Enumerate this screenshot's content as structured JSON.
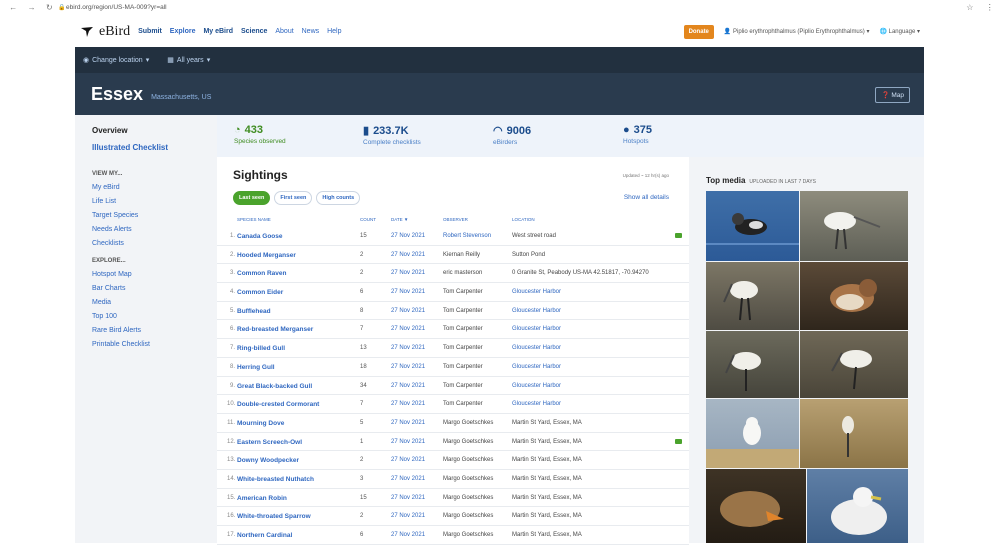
{
  "browser": {
    "url": "ebird.org/region/US-MA-009?yr=all"
  },
  "header": {
    "logo_text": "eBird",
    "nav": [
      "Submit",
      "Explore",
      "My eBird",
      "Science",
      "About",
      "News",
      "Help"
    ],
    "donate": "Donate",
    "user": "Piplio erythrophthalmus (Piplio Erythrophthalmus)",
    "language": "Language"
  },
  "subbar": {
    "change_location": "Change location",
    "years": "All years"
  },
  "banner": {
    "region": "Essex",
    "subregion": "Massachusetts, US",
    "map": "Map"
  },
  "sidebar": {
    "overview": "Overview",
    "illustrated": "Illustrated Checklist",
    "view_my_heading": "VIEW MY...",
    "view_my": [
      "My eBird",
      "Life List",
      "Target Species",
      "Needs Alerts",
      "Checklists"
    ],
    "explore_heading": "EXPLORE...",
    "explore": [
      "Hotspot Map",
      "Bar Charts",
      "Media",
      "Top 100",
      "Rare Bird Alerts",
      "Printable Checklist"
    ]
  },
  "stats": [
    {
      "value": "433",
      "label": "Species observed"
    },
    {
      "value": "233.7K",
      "label": "Complete checklists"
    },
    {
      "value": "9006",
      "label": "eBirders"
    },
    {
      "value": "375",
      "label": "Hotspots"
    }
  ],
  "sightings": {
    "title": "Sightings",
    "updated": "Updated ~ 12 hr(s) ago",
    "tabs": [
      "Last seen",
      "First seen",
      "High counts"
    ],
    "show_all": "Show all details",
    "columns": {
      "species": "SPECIES NAME",
      "count": "COUNT",
      "date": "DATE ▼",
      "observer": "OBSERVER",
      "location": "LOCATION"
    },
    "rows": [
      {
        "n": "1.",
        "species": "Canada Goose",
        "count": "15",
        "date": "27 Nov 2021",
        "observer": "Robert Stevenson",
        "location": "West street road",
        "comment": true
      },
      {
        "n": "2.",
        "species": "Hooded Merganser",
        "count": "2",
        "date": "27 Nov 2021",
        "observer": "Kiernan Reilly",
        "location": "Sutton Pond",
        "comment": false
      },
      {
        "n": "3.",
        "species": "Common Raven",
        "count": "2",
        "date": "27 Nov 2021",
        "observer": "eric masterson",
        "location": "0 Granite St, Peabody US-MA 42.51817, -70.94270",
        "comment": false
      },
      {
        "n": "4.",
        "species": "Common Eider",
        "count": "6",
        "date": "27 Nov 2021",
        "observer": "Tom Carpenter",
        "location": "Gloucester Harbor",
        "comment": false
      },
      {
        "n": "5.",
        "species": "Bufflehead",
        "count": "8",
        "date": "27 Nov 2021",
        "observer": "Tom Carpenter",
        "location": "Gloucester Harbor",
        "comment": false
      },
      {
        "n": "6.",
        "species": "Red-breasted Merganser",
        "count": "7",
        "date": "27 Nov 2021",
        "observer": "Tom Carpenter",
        "location": "Gloucester Harbor",
        "comment": false
      },
      {
        "n": "7.",
        "species": "Ring-billed Gull",
        "count": "13",
        "date": "27 Nov 2021",
        "observer": "Tom Carpenter",
        "location": "Gloucester Harbor",
        "comment": false
      },
      {
        "n": "8.",
        "species": "Herring Gull",
        "count": "18",
        "date": "27 Nov 2021",
        "observer": "Tom Carpenter",
        "location": "Gloucester Harbor",
        "comment": false
      },
      {
        "n": "9.",
        "species": "Great Black-backed Gull",
        "count": "34",
        "date": "27 Nov 2021",
        "observer": "Tom Carpenter",
        "location": "Gloucester Harbor",
        "comment": false
      },
      {
        "n": "10.",
        "species": "Double-crested Cormorant",
        "count": "7",
        "date": "27 Nov 2021",
        "observer": "Tom Carpenter",
        "location": "Gloucester Harbor",
        "comment": false
      },
      {
        "n": "11.",
        "species": "Mourning Dove",
        "count": "5",
        "date": "27 Nov 2021",
        "observer": "Margo Goetschkes",
        "location": "Martin St Yard, Essex, MA",
        "comment": false
      },
      {
        "n": "12.",
        "species": "Eastern Screech-Owl",
        "count": "1",
        "date": "27 Nov 2021",
        "observer": "Margo Goetschkes",
        "location": "Martin St Yard, Essex, MA",
        "comment": true
      },
      {
        "n": "13.",
        "species": "Downy Woodpecker",
        "count": "2",
        "date": "27 Nov 2021",
        "observer": "Margo Goetschkes",
        "location": "Martin St Yard, Essex, MA",
        "comment": false
      },
      {
        "n": "14.",
        "species": "White-breasted Nuthatch",
        "count": "3",
        "date": "27 Nov 2021",
        "observer": "Margo Goetschkes",
        "location": "Martin St Yard, Essex, MA",
        "comment": false
      },
      {
        "n": "15.",
        "species": "American Robin",
        "count": "15",
        "date": "27 Nov 2021",
        "observer": "Margo Goetschkes",
        "location": "Martin St Yard, Essex, MA",
        "comment": false
      },
      {
        "n": "16.",
        "species": "White-throated Sparrow",
        "count": "2",
        "date": "27 Nov 2021",
        "observer": "Margo Goetschkes",
        "location": "Martin St Yard, Essex, MA",
        "comment": false
      },
      {
        "n": "17.",
        "species": "Northern Cardinal",
        "count": "6",
        "date": "27 Nov 2021",
        "observer": "Margo Goetschkes",
        "location": "Martin St Yard, Essex, MA",
        "comment": false
      }
    ]
  },
  "media": {
    "title": "Top media",
    "subtitle": "UPLOADED IN LAST 7 DAYS"
  },
  "colors": {
    "dark_bar": "#22303f",
    "banner": "#2a3b4e",
    "link": "#2f67c0",
    "green": "#4aa32c",
    "donate": "#e3861d"
  }
}
